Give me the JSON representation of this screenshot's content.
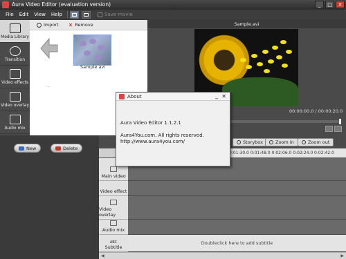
{
  "window": {
    "title": "Aura Video Editor (evaluation version)",
    "buttons": [
      "_",
      "□",
      "✕"
    ]
  },
  "menu": {
    "items": [
      "File",
      "Edit",
      "View",
      "Help"
    ],
    "save_movie": "Save movie"
  },
  "sidebar": {
    "items": [
      {
        "label": "Media Library",
        "icon": "film-icon"
      },
      {
        "label": "Transition",
        "icon": "transition-icon"
      },
      {
        "label": "Video effects",
        "icon": "effects-icon"
      },
      {
        "label": "Video overlay",
        "icon": "overlay-icon"
      },
      {
        "label": "Audio mix",
        "icon": "music-icon"
      }
    ]
  },
  "media": {
    "import": "Import",
    "remove": "Remove",
    "back_label": "..",
    "file_name": "Sample.avi"
  },
  "preview": {
    "title": "Sample.avi",
    "time_current": "00:00:00.0",
    "time_total": "00:00:20.0"
  },
  "timeline": {
    "new": "New",
    "delete": "Delete",
    "tools": [
      "Storybox",
      "Zoom in",
      "Zoom out"
    ],
    "ruler": "0:01:30.0 0:01:48.0 0:02:06.0 0:02:24.0 0:02:42.0",
    "tracks": [
      "Main video",
      "Video effect",
      "Video overlay",
      "Audio mix",
      "Subtitle"
    ],
    "subtitle_abc": "ABC",
    "subtitle_hint": "Doubleclick here to add subtitle"
  },
  "about": {
    "title": "About",
    "version": "Aura Video Editor 1.1.2.1",
    "copyright": "Aura4You.com.  All rights reserved.",
    "url": "http://www.aura4you.com/"
  },
  "colors": {
    "accent": "#7aa0d8",
    "title_bg": "#2c2c2c",
    "remove_red": "#c02020"
  }
}
